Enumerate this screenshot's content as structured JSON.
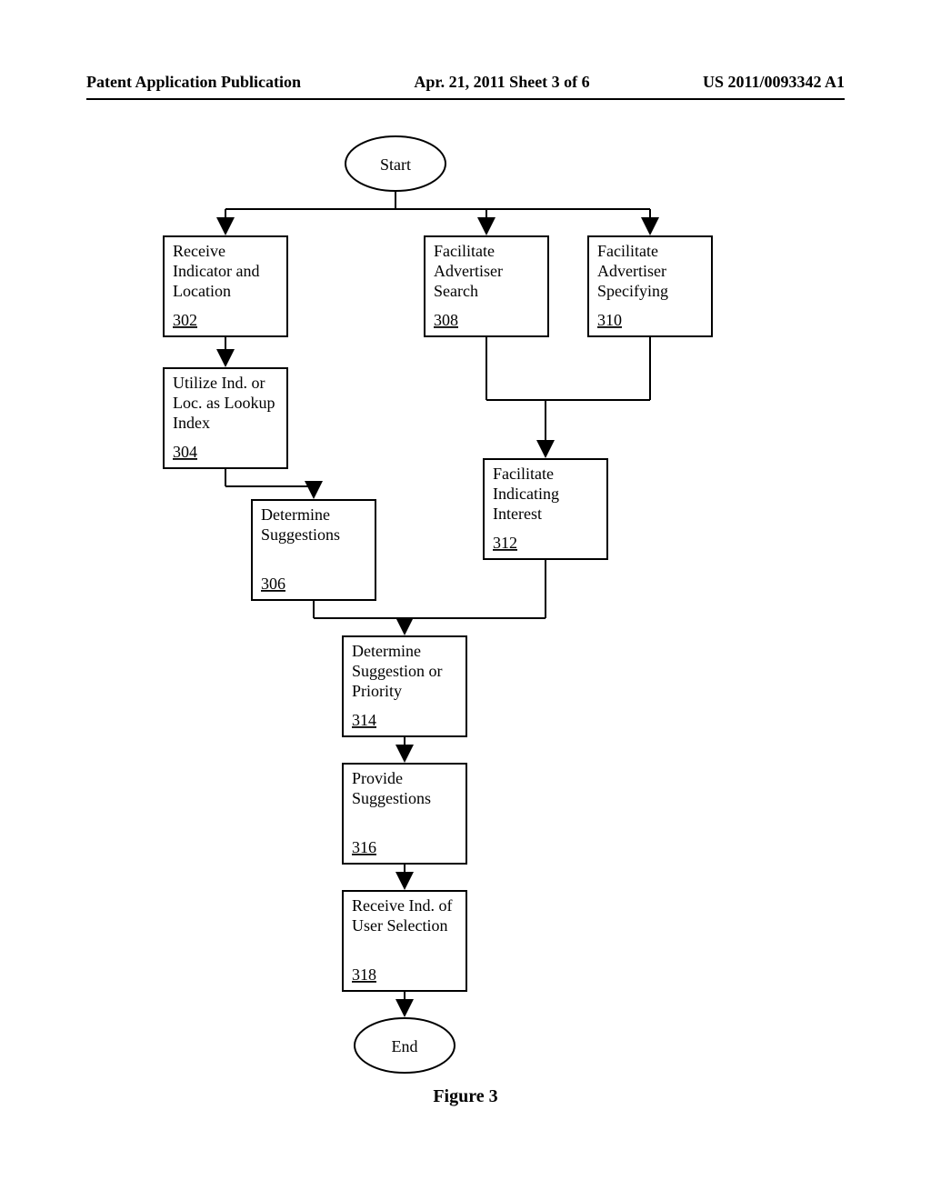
{
  "header": {
    "left": "Patent Application Publication",
    "center": "Apr. 21, 2011  Sheet 3 of 6",
    "right": "US 2011/0093342 A1"
  },
  "flow": {
    "start": "Start",
    "end": "End",
    "boxes": {
      "302": {
        "line1": "Receive",
        "line2": "Indicator and",
        "line3": "Location",
        "ref": "302"
      },
      "304": {
        "line1": "Utilize Ind. or",
        "line2": "Loc. as Lookup",
        "line3": "Index",
        "ref": "304"
      },
      "306": {
        "line1": "Determine",
        "line2": "Suggestions",
        "ref": "306"
      },
      "308": {
        "line1": "Facilitate",
        "line2": "Advertiser",
        "line3": "Search",
        "ref": "308"
      },
      "310": {
        "line1": "Facilitate",
        "line2": "Advertiser",
        "line3": "Specifying",
        "ref": "310"
      },
      "312": {
        "line1": "Facilitate",
        "line2": "Indicating",
        "line3": "Interest",
        "ref": "312"
      },
      "314": {
        "line1": "Determine",
        "line2": "Suggestion or",
        "line3": "Priority",
        "ref": "314"
      },
      "316": {
        "line1": "Provide",
        "line2": "Suggestions",
        "ref": "316"
      },
      "318": {
        "line1": "Receive Ind. of",
        "line2": "User Selection",
        "ref": "318"
      }
    }
  },
  "caption": "Figure 3"
}
